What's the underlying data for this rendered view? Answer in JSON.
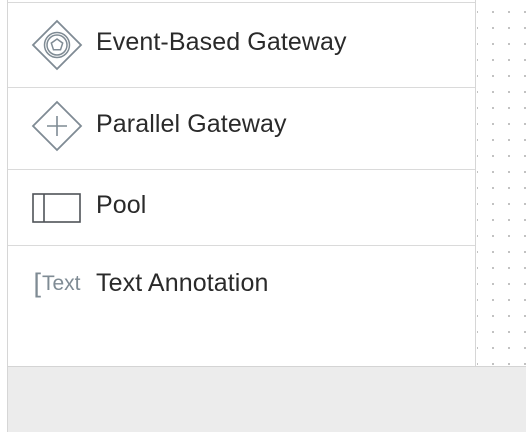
{
  "palette": {
    "items": [
      {
        "label": "Event-Based Gateway",
        "icon": "event-based-gateway-icon"
      },
      {
        "label": "Parallel Gateway",
        "icon": "parallel-gateway-icon"
      },
      {
        "label": "Pool",
        "icon": "pool-icon"
      },
      {
        "label": "Text Annotation",
        "icon": "text-annotation-icon",
        "icon_text": "Text"
      }
    ]
  },
  "colors": {
    "icon_stroke": "#7f8b94",
    "label_text": "#2a2a2a",
    "divider": "#dadada",
    "footer_bg": "#ececec",
    "canvas_dots": "#b9b9b9"
  }
}
